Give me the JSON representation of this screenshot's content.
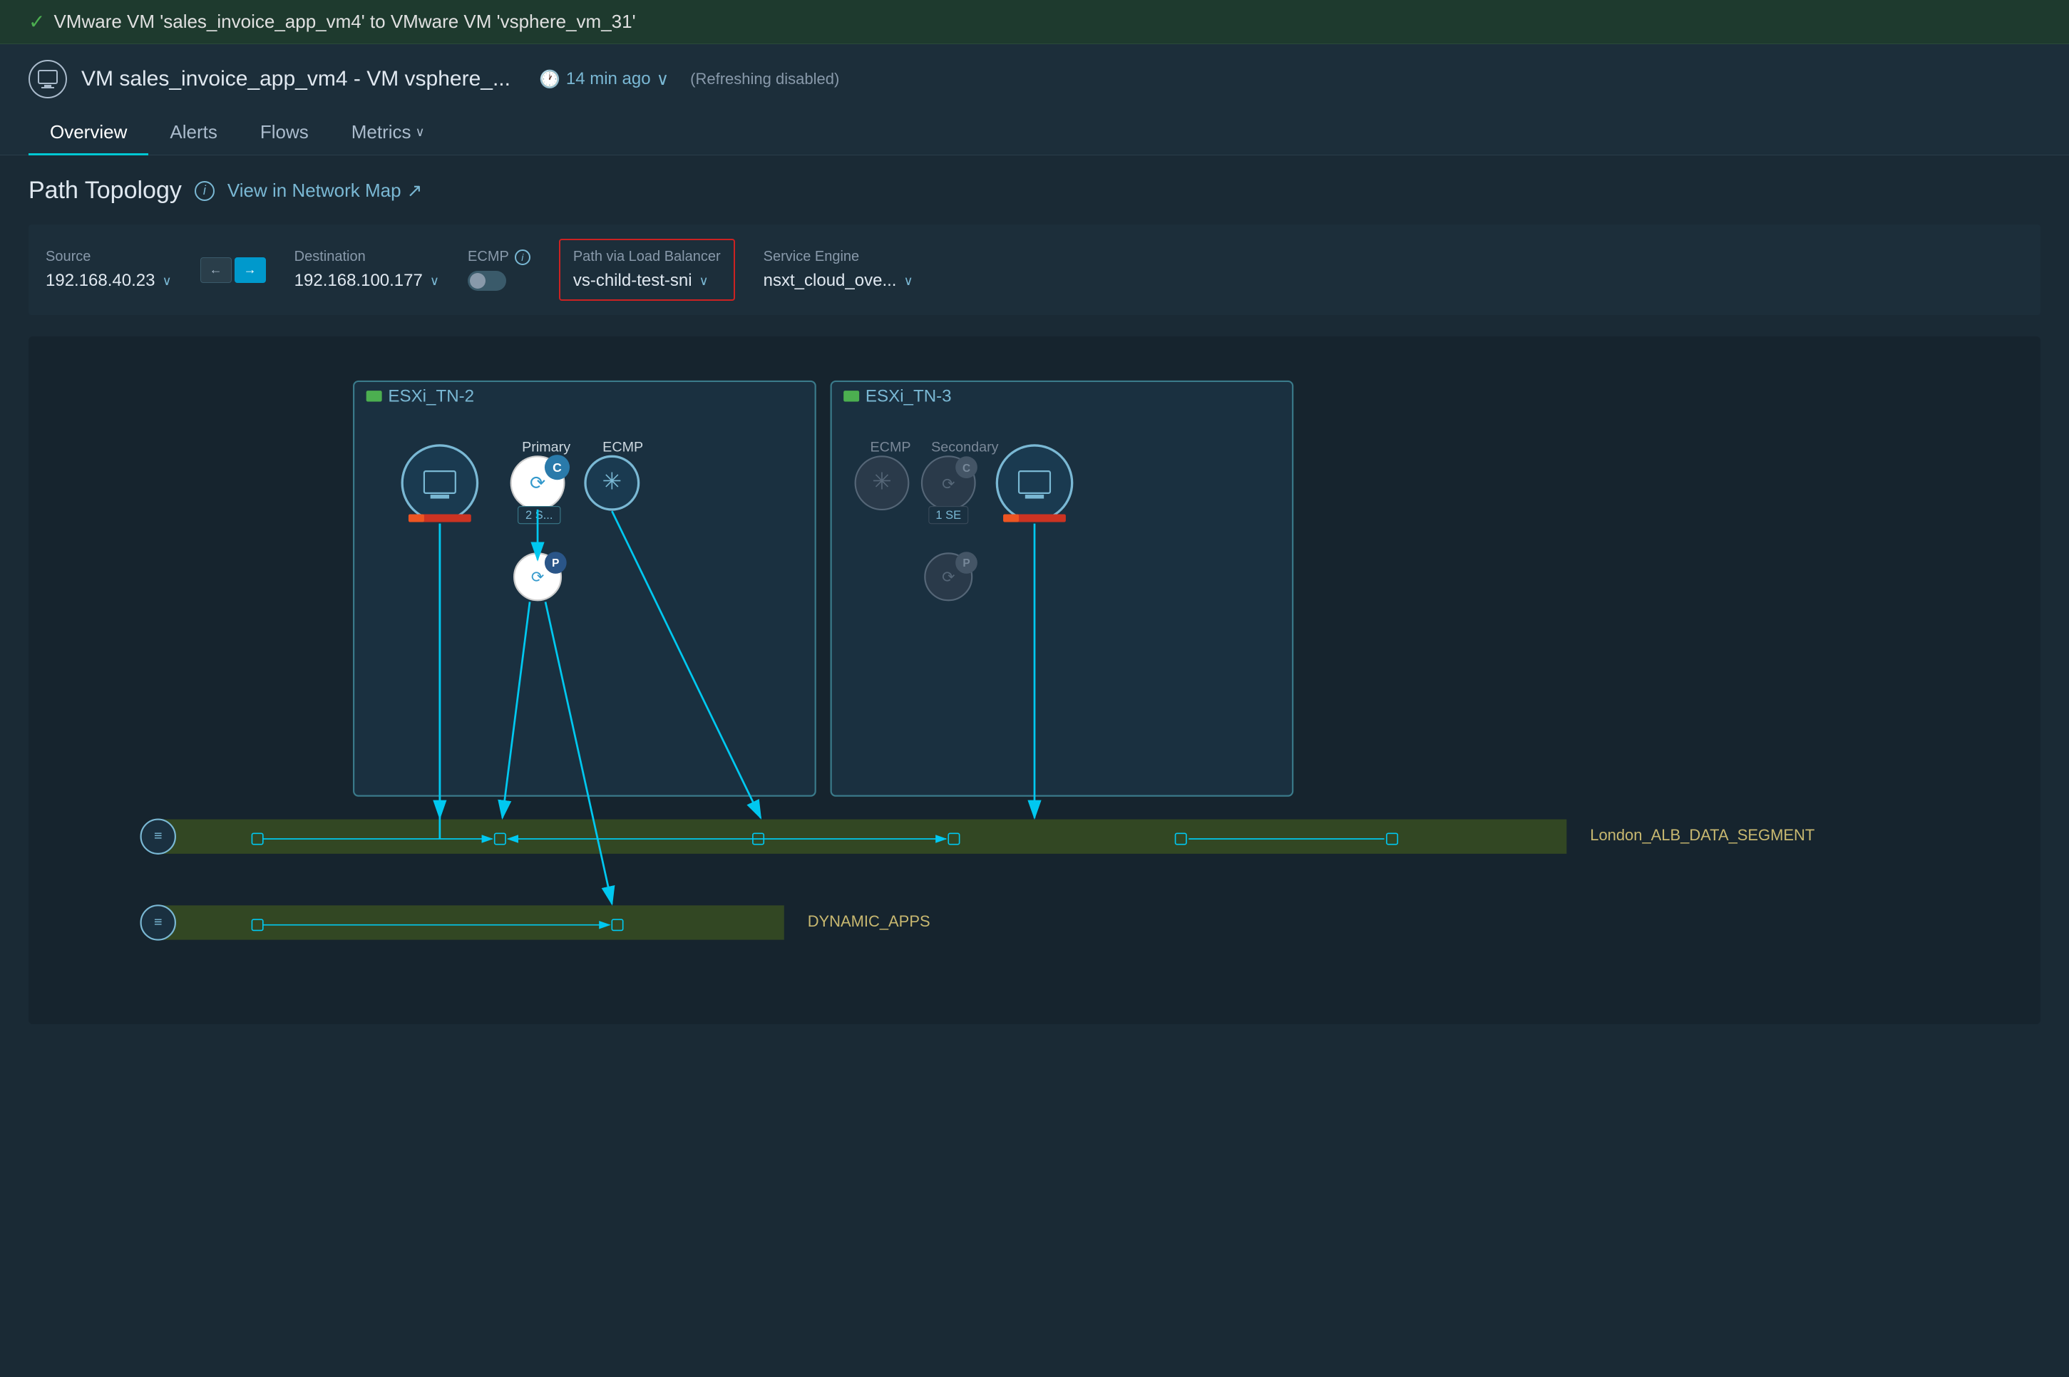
{
  "statusBar": {
    "icon": "✓",
    "text": "VMware VM 'sales_invoice_app_vm4' to VMware VM 'vsphere_vm_31'"
  },
  "header": {
    "vmLabel": "VM sales_invoice_app_vm4 - VM vsphere_...",
    "timeAgo": "14 min ago",
    "timeIcon": "🕐",
    "chevron": "∨",
    "refreshing": "(Refreshing  disabled)"
  },
  "tabs": [
    {
      "label": "Overview",
      "active": true
    },
    {
      "label": "Alerts",
      "active": false
    },
    {
      "label": "Flows",
      "active": false
    },
    {
      "label": "Metrics",
      "active": false,
      "hasChevron": true
    }
  ],
  "pathTopology": {
    "title": "Path Topology",
    "viewNetworkMap": "View in Network Map",
    "externalLinkIcon": "↗"
  },
  "controls": {
    "source": {
      "label": "Source",
      "value": "192.168.40.23"
    },
    "directionLeft": "←",
    "directionRight": "→",
    "destination": {
      "label": "Destination",
      "value": "192.168.100.177"
    },
    "ecmp": {
      "label": "ECMP",
      "toggled": false
    },
    "pathViaLB": {
      "label": "Path via Load Balancer",
      "value": "vs-child-test-sni"
    },
    "serviceEngine": {
      "label": "Service Engine",
      "value": "nsxt_cloud_ove..."
    }
  },
  "topology": {
    "esxi_nodes": [
      {
        "id": "esxi1",
        "label": "ESXi_TN-2"
      },
      {
        "id": "esxi2",
        "label": "ESXi_TN-3"
      }
    ],
    "node_labels": {
      "primary": "Primary",
      "ecmp1": "ECMP",
      "ecmp2": "ECMP",
      "secondary": "Secondary",
      "badge_2s": "2 S...",
      "badge_1se": "1 SE"
    },
    "segments": [
      {
        "id": "seg1",
        "name": "London_ALB_DATA_SEGMENT"
      },
      {
        "id": "seg2",
        "name": "DYNAMIC_APPS"
      }
    ]
  },
  "colors": {
    "accent": "#00c8f0",
    "background": "#1a2a35",
    "panelBg": "#1c2e3a",
    "esxiBorder": "#3a7a8a",
    "segmentBg": "#3a5020",
    "segmentLabel": "#c8b870",
    "lbHighlight": "#cc2222",
    "nodeBlue": "#7ab8d4"
  }
}
